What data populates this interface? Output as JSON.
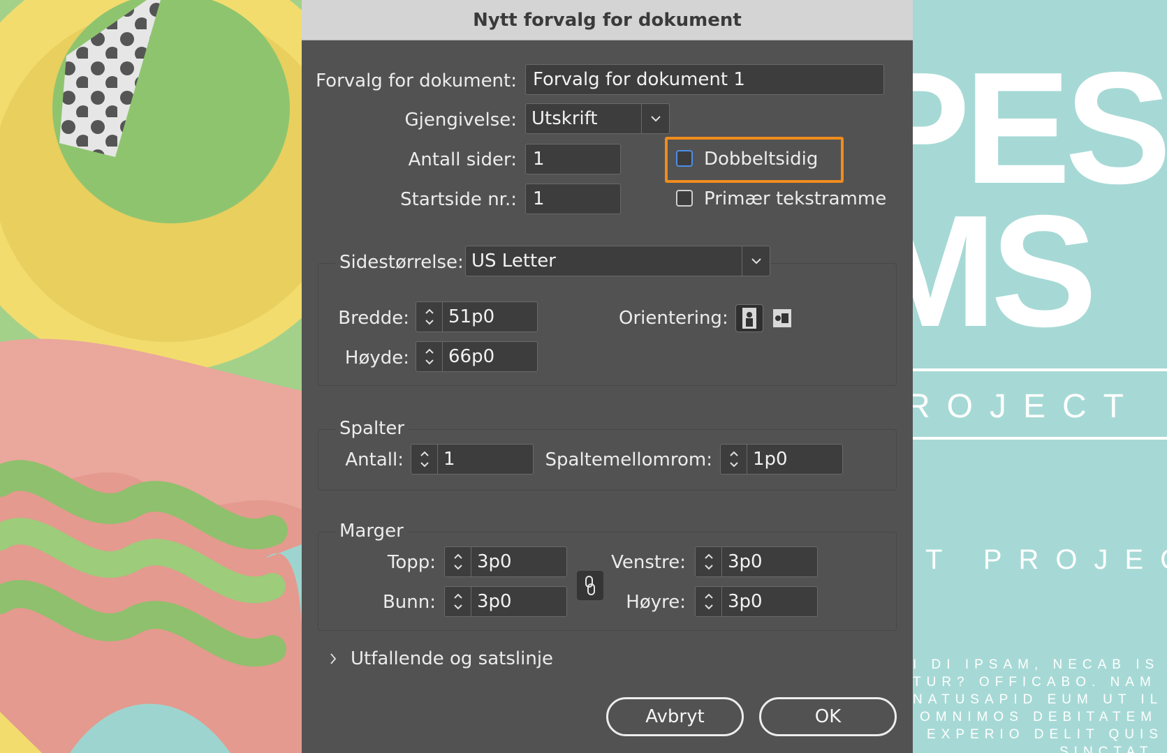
{
  "dialog": {
    "title": "Nytt forvalg for dokument",
    "preset": {
      "label": "Forvalg for dokument:",
      "value": "Forvalg for dokument 1"
    },
    "intent": {
      "label": "Gjengivelse:",
      "value": "Utskrift"
    },
    "pages": {
      "label": "Antall sider:",
      "value": "1"
    },
    "start_page": {
      "label": "Startside nr.:",
      "value": "1"
    },
    "facing_pages": {
      "label": "Dobbeltsidig",
      "checked": false
    },
    "primary_text_frame": {
      "label": "Primær tekstramme",
      "checked": false
    }
  },
  "page_size": {
    "label": "Sidestørrelse:",
    "value": "US Letter",
    "width": {
      "label": "Bredde:",
      "value": "51p0"
    },
    "height": {
      "label": "Høyde:",
      "value": "66p0"
    },
    "orientation": {
      "label": "Orientering:",
      "selected": "portrait"
    }
  },
  "columns": {
    "title": "Spalter",
    "count": {
      "label": "Antall:",
      "value": "1"
    },
    "gutter": {
      "label": "Spaltemellomrom:",
      "value": "1p0"
    }
  },
  "margins": {
    "title": "Marger",
    "top": {
      "label": "Topp:",
      "value": "3p0"
    },
    "bottom": {
      "label": "Bunn:",
      "value": "3p0"
    },
    "left": {
      "label": "Venstre:",
      "value": "3p0"
    },
    "right": {
      "label": "Høyre:",
      "value": "3p0"
    }
  },
  "bleed": {
    "label": "Utfallende og satslinje"
  },
  "buttons": {
    "cancel": "Avbryt",
    "ok": "OK"
  },
  "background_right": {
    "line1": "PES",
    "line2": "MS",
    "line3": "ROJECT",
    "line4": "T PROJECT",
    "body": [
      "I DI IPSAM, NECAB IS",
      "TUR? OFFICABO. NAM",
      "NATUSAPID EUM UT IL",
      "OMNIMOS DEBITATEM",
      "EXPERIO DELIT QUIS",
      "SINCTAT"
    ]
  },
  "colors": {
    "accent_highlight": "#f08c1e",
    "focus_ring": "#4f8ee6",
    "dialog_bg": "#525252"
  }
}
